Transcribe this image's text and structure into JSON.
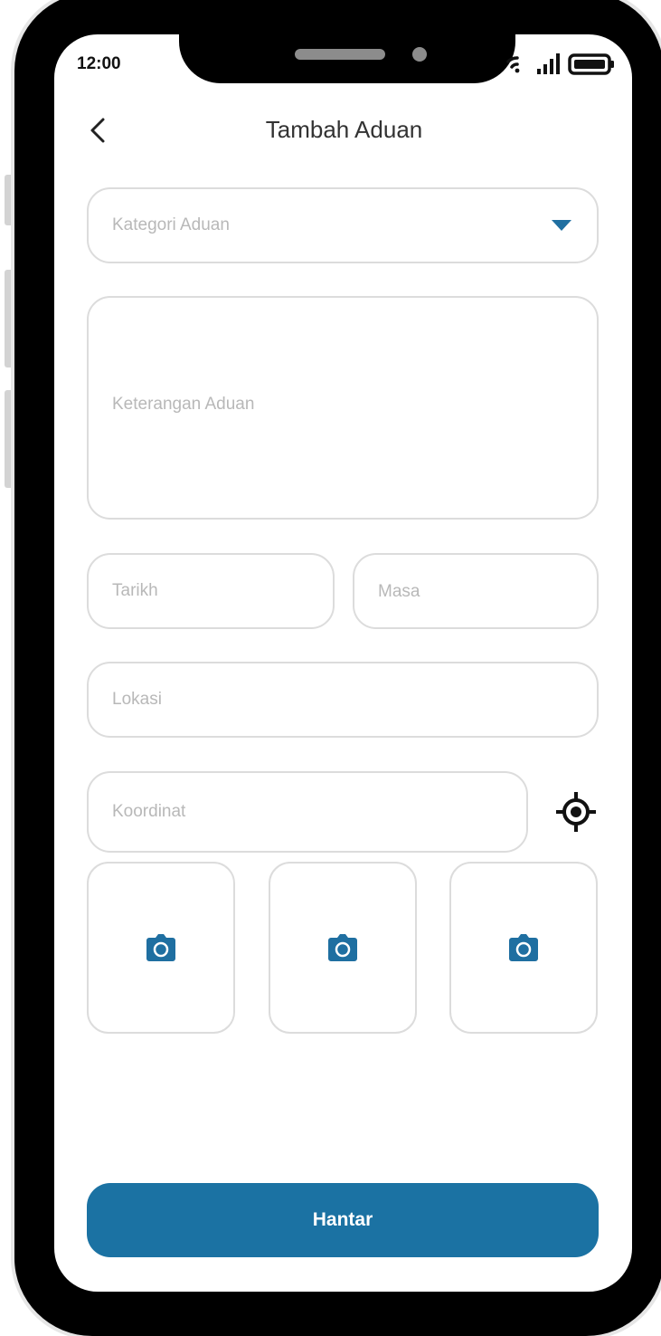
{
  "status_bar": {
    "time": "12:00",
    "icons": [
      "wifi-icon",
      "signal-icon",
      "battery-icon"
    ]
  },
  "header": {
    "back_icon": "chevron-left-icon",
    "title": "Tambah Aduan"
  },
  "form": {
    "category": {
      "placeholder": "Kategori Aduan",
      "icon": "caret-down-icon"
    },
    "description": {
      "placeholder": "Keterangan Aduan"
    },
    "date": {
      "placeholder": "Tarikh"
    },
    "time": {
      "placeholder": "Masa"
    },
    "location": {
      "placeholder": "Lokasi"
    },
    "coordinates": {
      "placeholder": "Koordinat",
      "icon": "locate-target-icon"
    },
    "photos": [
      {
        "icon": "camera-icon"
      },
      {
        "icon": "camera-icon"
      },
      {
        "icon": "camera-icon"
      }
    ]
  },
  "submit_label": "Hantar",
  "colors": {
    "accent": "#1b72a3",
    "icon_blue": "#1f6fa1",
    "border": "#dcdcdc",
    "placeholder": "#b8b8b8",
    "device_frame": "#000000"
  }
}
